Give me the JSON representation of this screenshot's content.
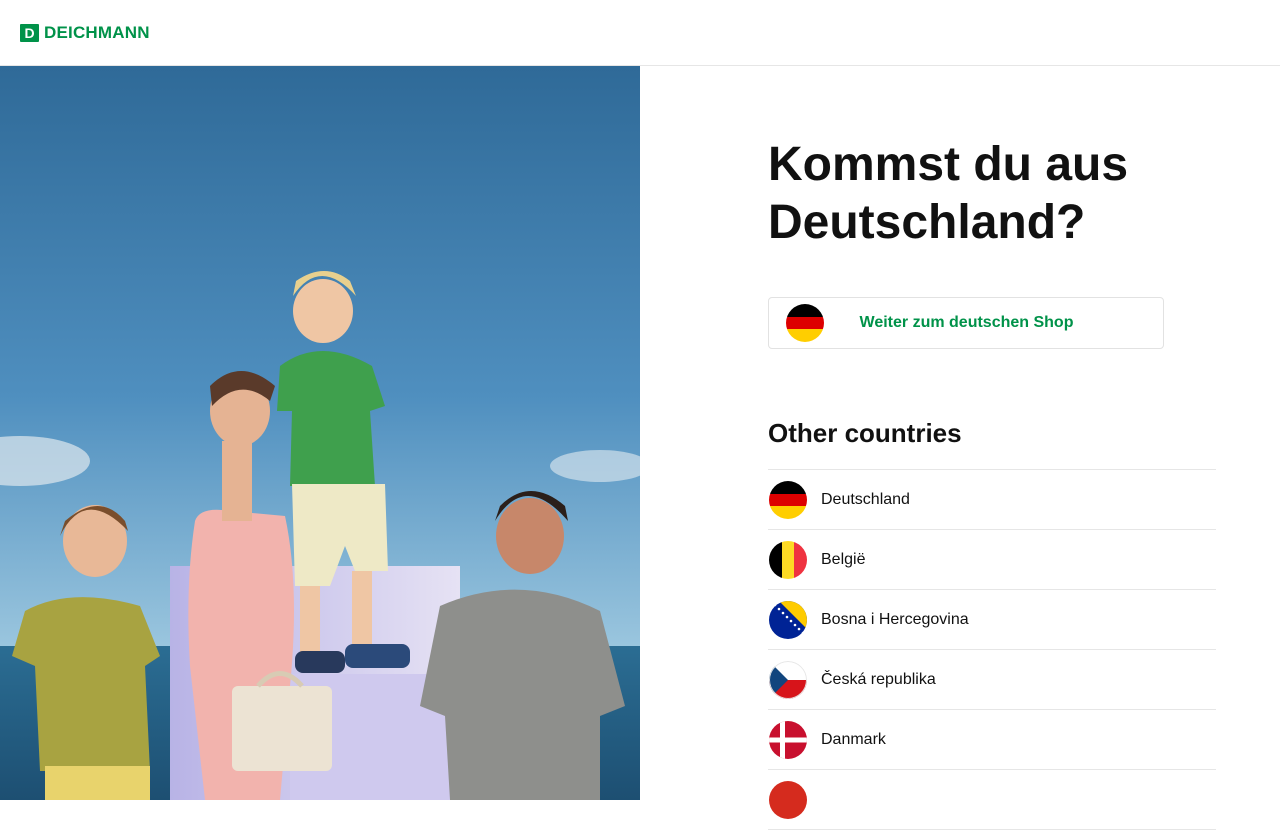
{
  "brand": {
    "logo_letter": "D",
    "name": "DEICHMANN",
    "color": "#009249"
  },
  "hero": {
    "alt": "family-photo"
  },
  "main": {
    "headline_line1": "Kommst du aus",
    "headline_line2": "Deutschland?",
    "primary_button": {
      "label": "Weiter zum deutschen Shop",
      "flag": "flag-de-icon"
    },
    "other_title": "Other countries",
    "countries": [
      {
        "name": "Deutschland",
        "flag": "flag-de-icon"
      },
      {
        "name": "België",
        "flag": "flag-be-icon"
      },
      {
        "name": "Bosna i Hercegovina",
        "flag": "flag-ba-icon"
      },
      {
        "name": "Česká republika",
        "flag": "flag-cz-icon"
      },
      {
        "name": "Danmark",
        "flag": "flag-dk-icon"
      },
      {
        "name": "",
        "flag": "flag-partial-icon"
      }
    ]
  }
}
